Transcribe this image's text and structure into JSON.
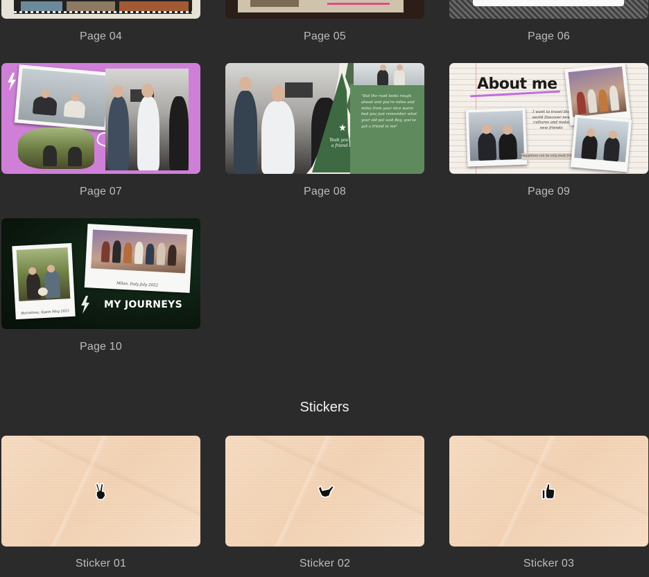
{
  "pages": [
    {
      "label": "Page 04"
    },
    {
      "label": "Page 05"
    },
    {
      "label": "Page 06"
    },
    {
      "label": "Page 07"
    },
    {
      "label": "Page 08",
      "note_text": "\"But the road looks rough ahead and you're miles and miles from your nice warm bed you just remember what your old pal said Boy, you've got a friend in me\"",
      "tree_text": "Yeah you've got a friend in me"
    },
    {
      "label": "Page 09",
      "title": "About me",
      "note_text": "I want to travel the world Discover new cultures and make new friends",
      "caption": "Happiness can be only lead/ friends forever"
    },
    {
      "label": "Page 10",
      "title": "MY JOURNEYS",
      "caption_1": "Milan, Italy July 2022",
      "caption_2": "Barcelona, Spain May 2021"
    }
  ],
  "stickers_section": {
    "title": "Stickers"
  },
  "stickers": [
    {
      "label": "Sticker 01",
      "icon": "victory-hand-icon"
    },
    {
      "label": "Sticker 02",
      "icon": "call-me-hand-icon"
    },
    {
      "label": "Sticker 03",
      "icon": "thumbs-up-icon"
    }
  ],
  "colors": {
    "background": "#2c2b2c",
    "page07_bg": "#cf7fd8",
    "page08_bg": "#4e6b4a",
    "page10_bg": "#0c1a0f",
    "about_underline": "#c06be0",
    "sticker_bg": "#f4d6b8"
  }
}
